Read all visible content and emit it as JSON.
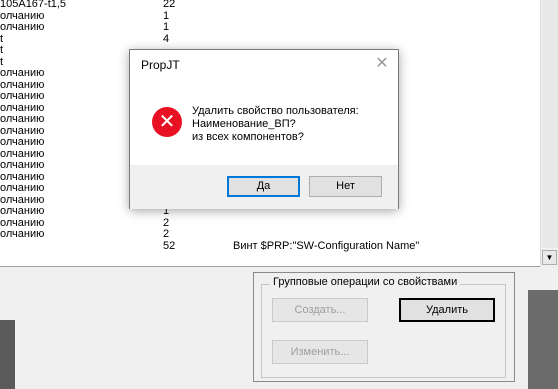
{
  "list": {
    "rows": [
      {
        "name": "105A167-t1,5",
        "count": "22",
        "value": ""
      },
      {
        "name": "олчанию",
        "count": "1",
        "value": ""
      },
      {
        "name": "олчанию",
        "count": "1",
        "value": ""
      },
      {
        "name": "t",
        "count": "4",
        "value": ""
      },
      {
        "name": "t",
        "count": "",
        "value": ""
      },
      {
        "name": "t",
        "count": "",
        "value": ""
      },
      {
        "name": "олчанию",
        "count": "",
        "value": ""
      },
      {
        "name": "олчанию",
        "count": "",
        "value": ""
      },
      {
        "name": "олчанию",
        "count": "",
        "value": ""
      },
      {
        "name": "олчанию",
        "count": "",
        "value": ""
      },
      {
        "name": "олчанию",
        "count": "",
        "value": ""
      },
      {
        "name": "олчанию",
        "count": "",
        "value": ""
      },
      {
        "name": "олчанию",
        "count": "",
        "value": ""
      },
      {
        "name": "олчанию",
        "count": "",
        "value": ""
      },
      {
        "name": "олчанию",
        "count": "",
        "value": ""
      },
      {
        "name": "олчанию",
        "count": "",
        "value": ""
      },
      {
        "name": "олчанию",
        "count": "",
        "value": ""
      },
      {
        "name": "олчанию",
        "count": "1",
        "value": ""
      },
      {
        "name": "олчанию",
        "count": "1",
        "value": ""
      },
      {
        "name": "олчанию",
        "count": "2",
        "value": ""
      },
      {
        "name": "олчанию",
        "count": "2",
        "value": ""
      },
      {
        "name": "",
        "count": "52",
        "value": "Винт $PRP:\"SW-Configuration Name\""
      }
    ]
  },
  "scrollbar": {
    "down_arrow": "▼"
  },
  "group": {
    "title": "Групповые операции со свойствами",
    "create_label": "Создать...",
    "delete_label": "Удалить",
    "edit_label": "Изменить..."
  },
  "dialog": {
    "title": "PropJT",
    "close_glyph": "✕",
    "icon_glyph": "✕",
    "message_lines": [
      "Удалить свойство пользователя:",
      "Наименование_ВП?",
      "из всех компонентов?"
    ],
    "yes_label": "Да",
    "no_label": "Нет"
  },
  "colors": {
    "error_icon": "#e81123",
    "default_button_border": "#0078d7"
  }
}
